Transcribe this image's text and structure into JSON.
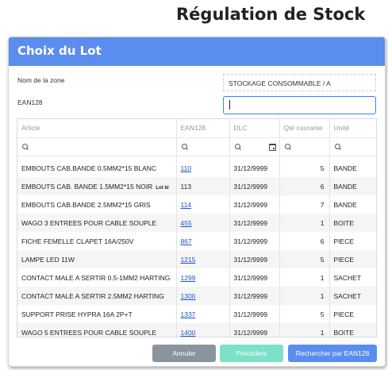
{
  "page": {
    "title": "Régulation de Stock"
  },
  "dialog": {
    "title": "Choix du Lot",
    "zone_label": "Nom de la zone",
    "zone_value": "STOCKAGE CONSOMMABLE / A",
    "ean_label": "EAN128",
    "ean_value": ""
  },
  "grid": {
    "columns": [
      "Article",
      "EAN128",
      "DLC",
      "Qté courante",
      "Unité"
    ],
    "rows": [
      {
        "article": "EMBOUTS CAB.BANDE 0.5MM2*15 BLANC",
        "tag": "",
        "ean": "110",
        "ean_link": true,
        "dlc": "31/12/9999",
        "qty": "5",
        "unit": "BANDE"
      },
      {
        "article": "EMBOUTS CAB. BANDE 1.5MM2*15 NOIR",
        "tag": "Lot bl",
        "ean": "113",
        "ean_link": false,
        "dlc": "31/12/9999",
        "qty": "6",
        "unit": "BANDE"
      },
      {
        "article": "EMBOUTS CAB.BANDE 2.5MM2*15 GRIS",
        "tag": "",
        "ean": "114",
        "ean_link": true,
        "dlc": "31/12/9999",
        "qty": "7",
        "unit": "BANDE"
      },
      {
        "article": "WAGO 3 ENTREES POUR CABLE SOUPLE",
        "tag": "",
        "ean": "455",
        "ean_link": true,
        "dlc": "31/12/9999",
        "qty": "1",
        "unit": "BOITE"
      },
      {
        "article": "FICHE FEMELLE CLAPET 16A/250V",
        "tag": "",
        "ean": "867",
        "ean_link": true,
        "dlc": "31/12/9999",
        "qty": "6",
        "unit": "PIECE"
      },
      {
        "article": "LAMPE LED 11W",
        "tag": "",
        "ean": "1215",
        "ean_link": true,
        "dlc": "31/12/9999",
        "qty": "5",
        "unit": "PIECE"
      },
      {
        "article": "CONTACT MALE A SERTIR 0.5-1MM2 HARTING",
        "tag": "",
        "ean": "1299",
        "ean_link": true,
        "dlc": "31/12/9999",
        "qty": "1",
        "unit": "SACHET"
      },
      {
        "article": "CONTACT MALE A SERTIR 2.5MM2 HARTING",
        "tag": "",
        "ean": "1300",
        "ean_link": true,
        "dlc": "31/12/9999",
        "qty": "1",
        "unit": "SACHET"
      },
      {
        "article": "SUPPORT PRISE HYPRA 16A 2P+T",
        "tag": "",
        "ean": "1337",
        "ean_link": true,
        "dlc": "31/12/9999",
        "qty": "5",
        "unit": "PIECE"
      },
      {
        "article": "WAGO 5 ENTREES POUR CABLE SOUPLE",
        "tag": "",
        "ean": "1400",
        "ean_link": true,
        "dlc": "31/12/9999",
        "qty": "1",
        "unit": "BOITE"
      }
    ]
  },
  "buttons": {
    "cancel": "Annuler",
    "previous": "Précédent",
    "search": "Rechercher par EAN128"
  },
  "colors": {
    "header": "#5b8def",
    "cancel": "#8a949f",
    "previous": "#7de0c8",
    "search": "#5b8def",
    "link": "#1a55c8",
    "focus": "#2f86ff"
  },
  "icons": {
    "filter": "search-icon",
    "date_filter": "calendar-icon"
  }
}
